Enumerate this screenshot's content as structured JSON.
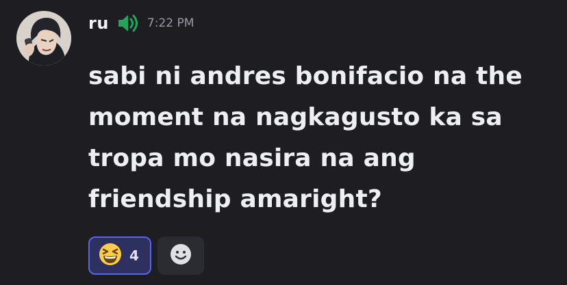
{
  "message": {
    "author": "ru",
    "timestamp": "7:22 PM",
    "content": "sabi ni andres bonifacio na the moment na nagkagusto ka sa tropa mo nasira na ang friendship amaright?"
  },
  "icons": {
    "avatar": "user-avatar",
    "speaker": "speaker-icon",
    "reaction_emoji": "laughing-squinting-face-icon",
    "add_reaction": "add-reaction-smiley-icon"
  },
  "reactions": [
    {
      "emoji": "laughing-squinting-face",
      "count": "4",
      "active": true
    }
  ],
  "colors": {
    "background": "#1e1e22",
    "text": "#eeeff2",
    "timestamp": "#9a9ba3",
    "speaker": "#23a559",
    "reaction_active_bg": "#2e3060",
    "reaction_active_border": "#5865f2",
    "add_reaction_bg": "#2b2c31"
  }
}
